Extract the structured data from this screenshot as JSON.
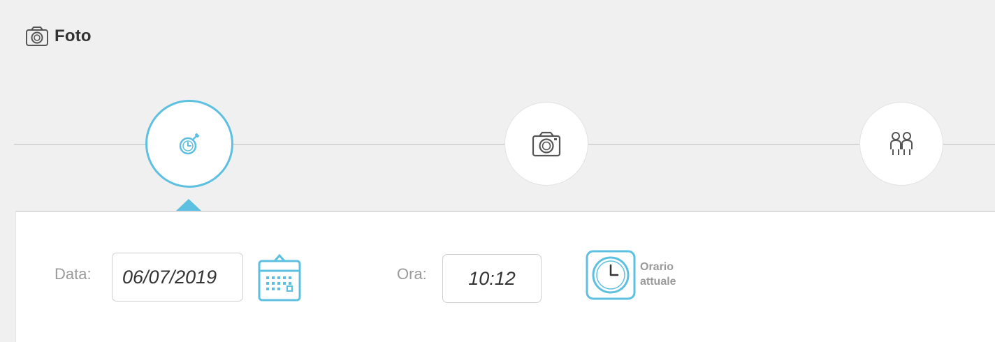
{
  "header": {
    "title": "Foto",
    "icon": "camera-icon"
  },
  "steps": [
    {
      "icon": "stopwatch-icon",
      "active": true
    },
    {
      "icon": "camera-icon",
      "active": false
    },
    {
      "icon": "people-icon",
      "active": false
    }
  ],
  "form": {
    "date_label": "Data:",
    "date_value": "06/07/2019",
    "time_label": "Ora:",
    "time_value": "10:12",
    "now_label_line1": "Orario",
    "now_label_line2": "attuale"
  },
  "colors": {
    "accent": "#5ec0e0",
    "background": "#f0f0f0",
    "panel": "#ffffff"
  }
}
